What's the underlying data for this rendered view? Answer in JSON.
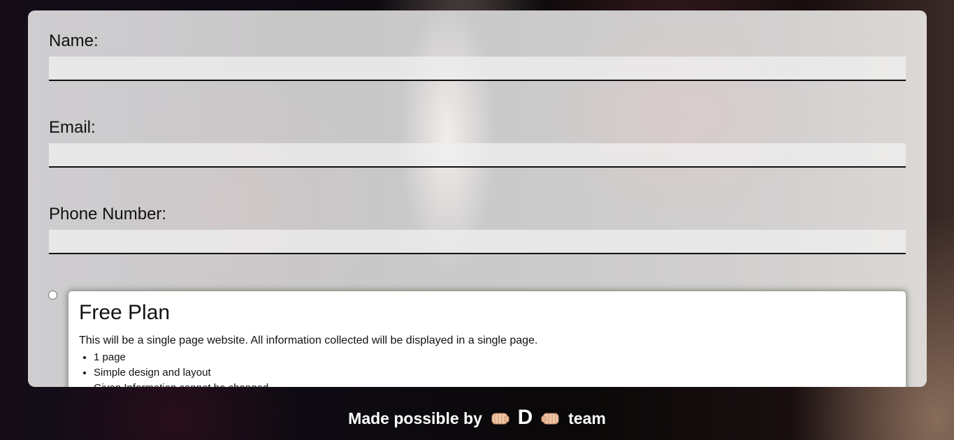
{
  "form": {
    "name_label": "Name:",
    "name_value": "",
    "email_label": "Email:",
    "email_value": "",
    "phone_label": "Phone Number:",
    "phone_value": ""
  },
  "plan": {
    "selected": false,
    "title": "Free Plan",
    "description": "This will be a single page website. All information collected will be displayed in a single page.",
    "features": [
      "1 page",
      "Simple design and layout",
      "Given Information cannot be changed"
    ]
  },
  "footer": {
    "prefix": "Made possible by",
    "left_icon": "left-facing-fist-icon",
    "letter": "D",
    "right_icon": "right-facing-fist-icon",
    "suffix": "team"
  }
}
